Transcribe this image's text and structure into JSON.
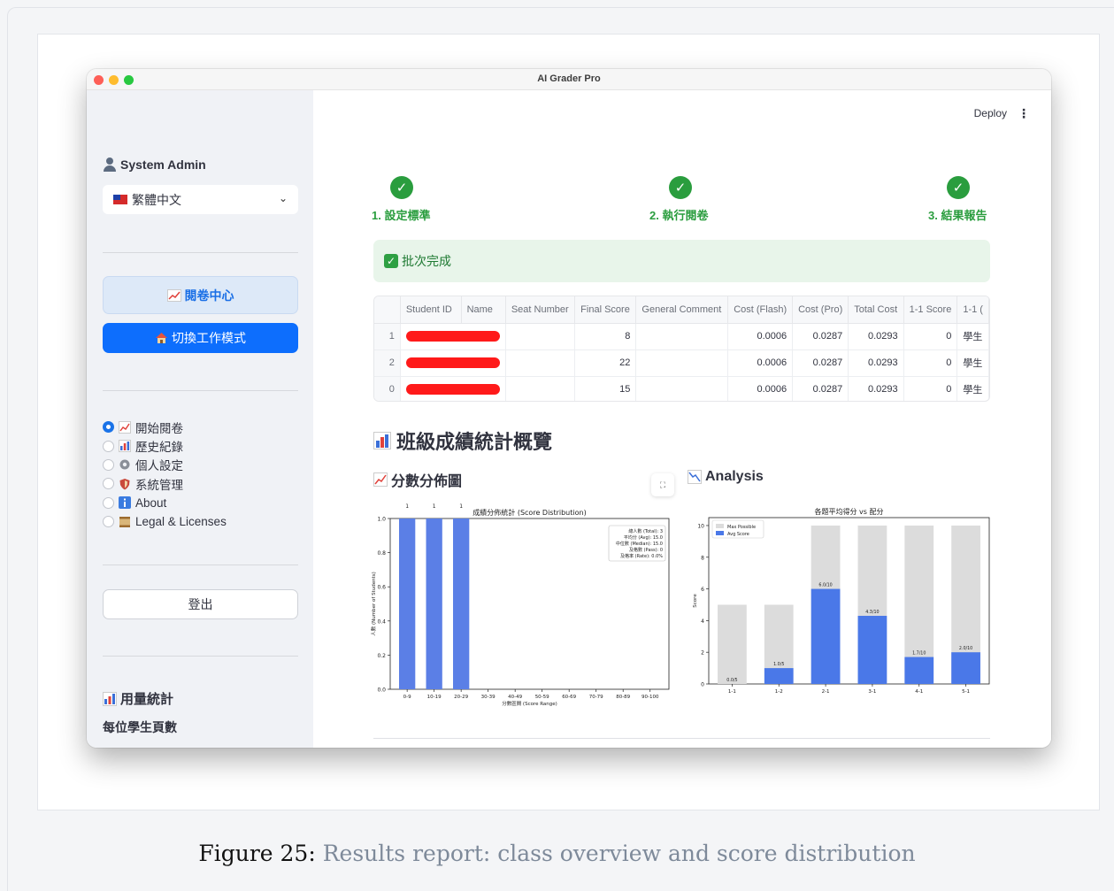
{
  "caption": {
    "number": "Figure 25:",
    "text": "Results report: class overview and score distribution"
  },
  "window": {
    "title": "AI Grader Pro"
  },
  "sidebar": {
    "user": "System Admin",
    "language": "繁體中文",
    "nav_primary": "閱卷中心",
    "nav_mode": "切換工作模式",
    "menu": [
      {
        "label": "開始閱卷",
        "icon": "chart-up-icon",
        "selected": true
      },
      {
        "label": "歷史紀錄",
        "icon": "bar-chart-icon",
        "selected": false
      },
      {
        "label": "個人設定",
        "icon": "gear-icon",
        "selected": false
      },
      {
        "label": "系統管理",
        "icon": "shield-icon",
        "selected": false
      },
      {
        "label": "About",
        "icon": "info-icon",
        "selected": false
      },
      {
        "label": "Legal & Licenses",
        "icon": "scroll-icon",
        "selected": false
      }
    ],
    "logout": "登出",
    "usage_title": "用量統計",
    "usage_sub": "每位學生頁數"
  },
  "header": {
    "deploy": "Deploy",
    "menu": "⋮"
  },
  "steps": [
    {
      "label": "1. 設定標準",
      "mark": "✓"
    },
    {
      "label": "2. 執行閱卷",
      "mark": "✓"
    },
    {
      "label": "3. 結果報告",
      "mark": "✓"
    }
  ],
  "success": {
    "text": "批次完成",
    "mark": "✓"
  },
  "table": {
    "columns": [
      "",
      "Student ID",
      "Name",
      "Seat Number",
      "Final Score",
      "General Comment",
      "Cost (Flash)",
      "Cost (Pro)",
      "Total Cost",
      "1-1 Score",
      "1-1 ("
    ],
    "rows": [
      {
        "idx": "1",
        "final": "8",
        "comment": "",
        "flash": "0.0006",
        "pro": "0.0287",
        "total": "0.0293",
        "s11": "0",
        "c11": "學生"
      },
      {
        "idx": "2",
        "final": "22",
        "comment": "",
        "flash": "0.0006",
        "pro": "0.0287",
        "total": "0.0293",
        "s11": "0",
        "c11": "學生"
      },
      {
        "idx": "0",
        "final": "15",
        "comment": "",
        "flash": "0.0006",
        "pro": "0.0287",
        "total": "0.0293",
        "s11": "0",
        "c11": "學生"
      }
    ]
  },
  "stats": {
    "title": "班級成績統計概覽",
    "dist_title": "分數分佈圖",
    "analysis_title": "Analysis",
    "expand": "⛶"
  },
  "chart_data": [
    {
      "type": "bar",
      "title": "成績分佈統計 (Score Distribution)",
      "xlabel": "分數區間 (Score Range)",
      "ylabel": "人數 (Number of Students)",
      "categories": [
        "0-9",
        "10-19",
        "20-29",
        "30-39",
        "40-49",
        "50-59",
        "60-69",
        "70-79",
        "80-89",
        "90-100"
      ],
      "values": [
        1,
        1,
        1,
        0,
        0,
        0,
        0,
        0,
        0,
        0
      ],
      "data_labels": [
        "1",
        "1",
        "1"
      ],
      "ylim": [
        0,
        1.0
      ],
      "yticks": [
        "0.0",
        "0.2",
        "0.4",
        "0.6",
        "0.8",
        "1.0"
      ],
      "color": "#5b7fe6",
      "legend_text": [
        "總人數 (Total): 3",
        "平均分 (Avg): 15.0",
        "中位數 (Median): 15.0",
        "及格數 (Pass): 0",
        "及格率 (Rate): 0.0%"
      ],
      "legend_position": "top-right"
    },
    {
      "type": "bar",
      "title": "各題平均得分 vs 配分",
      "ylabel": "Score",
      "categories": [
        "1-1",
        "1-2",
        "2-1",
        "3-1",
        "4-1",
        "5-1"
      ],
      "series": [
        {
          "name": "Max Possible",
          "values": [
            5,
            5,
            10,
            10,
            10,
            10
          ],
          "color": "#dcdcdc"
        },
        {
          "name": "Avg Score",
          "values": [
            0.0,
            1.0,
            6.0,
            4.3,
            1.7,
            2.0
          ],
          "color": "#4a78e8"
        }
      ],
      "data_labels": [
        "0.0/5",
        "1.0/5",
        "6.0/10",
        "4.3/10",
        "1.7/10",
        "2.0/10"
      ],
      "ylim": [
        0,
        10
      ],
      "yticks": [
        "0",
        "2",
        "4",
        "6",
        "8",
        "10"
      ],
      "legend_position": "top-left"
    }
  ]
}
